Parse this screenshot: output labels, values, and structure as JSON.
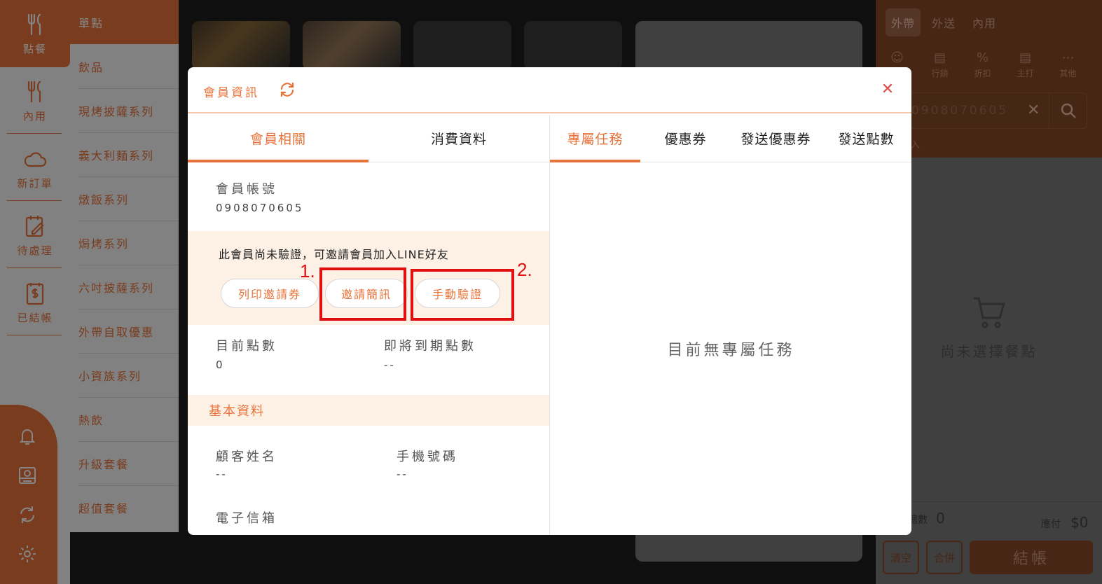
{
  "rail": {
    "items": [
      {
        "label": "點餐",
        "icon": "utensils-icon"
      },
      {
        "label": "內用",
        "icon": "utensils-icon"
      },
      {
        "label": "新訂單",
        "icon": "cloud-icon"
      },
      {
        "label": "待處理",
        "icon": "edit-note-icon"
      },
      {
        "label": "已結帳",
        "icon": "receipt-dollar-icon"
      }
    ],
    "bottom_icons": [
      "bell-icon",
      "cash-register-icon",
      "sync-icon",
      "gear-icon"
    ]
  },
  "categories": [
    "單點",
    "飲品",
    "現烤披薩系列",
    "義大利麵系列",
    "燉飯系列",
    "焗烤系列",
    "六吋披薩系列",
    "外帶自取優惠",
    "小資族系列",
    "熱飲",
    "升級套餐",
    "超值套餐"
  ],
  "cart": {
    "tabs": [
      "外帶",
      "外送",
      "內用"
    ],
    "tools": [
      {
        "label": "",
        "icon": "user-icon"
      },
      {
        "label": "行銷",
        "icon": "wallet-icon"
      },
      {
        "label": "折扣",
        "icon": "percent-icon"
      },
      {
        "label": "主打",
        "icon": "wallet-icon"
      },
      {
        "label": "其他",
        "icon": "more-icon"
      }
    ],
    "search_value": "0908070605",
    "sub_text": "入",
    "empty_text": "尚未選擇餐點",
    "count_label": "總數",
    "count_value": "0",
    "due_label": "應付",
    "due_value": "$0",
    "clear_label": "清空",
    "merge_label": "合併",
    "checkout_label": "結帳"
  },
  "modal": {
    "title": "會員資訊",
    "left_tabs": [
      "會員相關",
      "消費資料"
    ],
    "right_tabs": [
      "專屬任務",
      "優惠券",
      "發送優惠券",
      "發送點數"
    ],
    "account_label": "會員帳號",
    "account_value": "0908070605",
    "verify_message": "此會員尚未驗證，可邀請會員加入LINE好友",
    "btn_print": "列印邀請券",
    "btn_sms": "邀請簡訊",
    "btn_manual": "手動驗證",
    "annotation_1": "1.",
    "annotation_2": "2.",
    "points_label": "目前點數",
    "points_value": "0",
    "expiring_label": "即將到期點數",
    "expiring_value": "--",
    "basic_section": "基本資料",
    "name_label": "顧客姓名",
    "name_value": "--",
    "phone_label": "手機號碼",
    "phone_value": "--",
    "email_label": "電子信箱",
    "empty_task_text": "目前無專屬任務"
  },
  "colors": {
    "accent": "#e8733a",
    "annotation_red": "#e01010",
    "close_red": "#e04a4a",
    "cream": "#fdf1e5"
  }
}
